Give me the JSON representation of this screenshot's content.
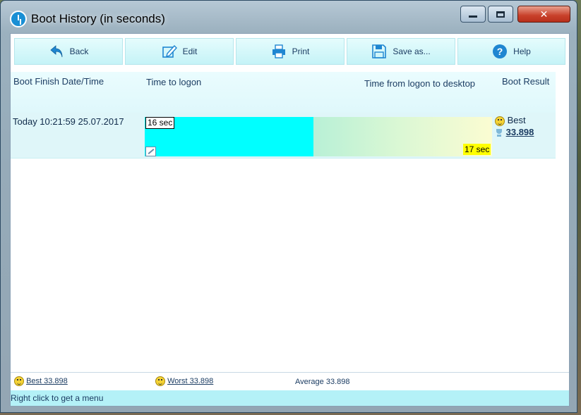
{
  "window": {
    "title": "Boot History (in seconds)",
    "controls": {
      "minimize": "minimize",
      "maximize": "maximize",
      "close": "✕"
    }
  },
  "toolbar": {
    "buttons": [
      {
        "label": "Back",
        "icon": "back-arrow-icon"
      },
      {
        "label": "Edit",
        "icon": "edit-icon"
      },
      {
        "label": "Print",
        "icon": "printer-icon"
      },
      {
        "label": "Save as...",
        "icon": "save-icon"
      },
      {
        "label": "Help",
        "icon": "help-icon"
      }
    ]
  },
  "table": {
    "headers": {
      "finish": "Boot Finish Date/Time",
      "logon": "Time to logon",
      "desktop": "Time from logon to desktop",
      "result": "Boot Result"
    },
    "rows": [
      {
        "date": "Today  10:21:59 25.07.2017",
        "logon_label": "16 sec",
        "logon_seconds": 16,
        "desktop_label": "17 sec",
        "desktop_seconds": 17,
        "result_label": "Best",
        "result_value": "33.898"
      }
    ]
  },
  "colors": {
    "logon_bar": "#00ffff",
    "desktop_gradient_start": "#b8f0d6",
    "desktop_gradient_end": "#fbfcd2",
    "desktop_label_bg": "#ffff00",
    "status_bar": "#b4f1f7"
  },
  "footer": {
    "best": "Best 33.898",
    "worst": "Worst 33.898",
    "average": "Average 33.898"
  },
  "status": {
    "text": "Right click to get a menu"
  }
}
